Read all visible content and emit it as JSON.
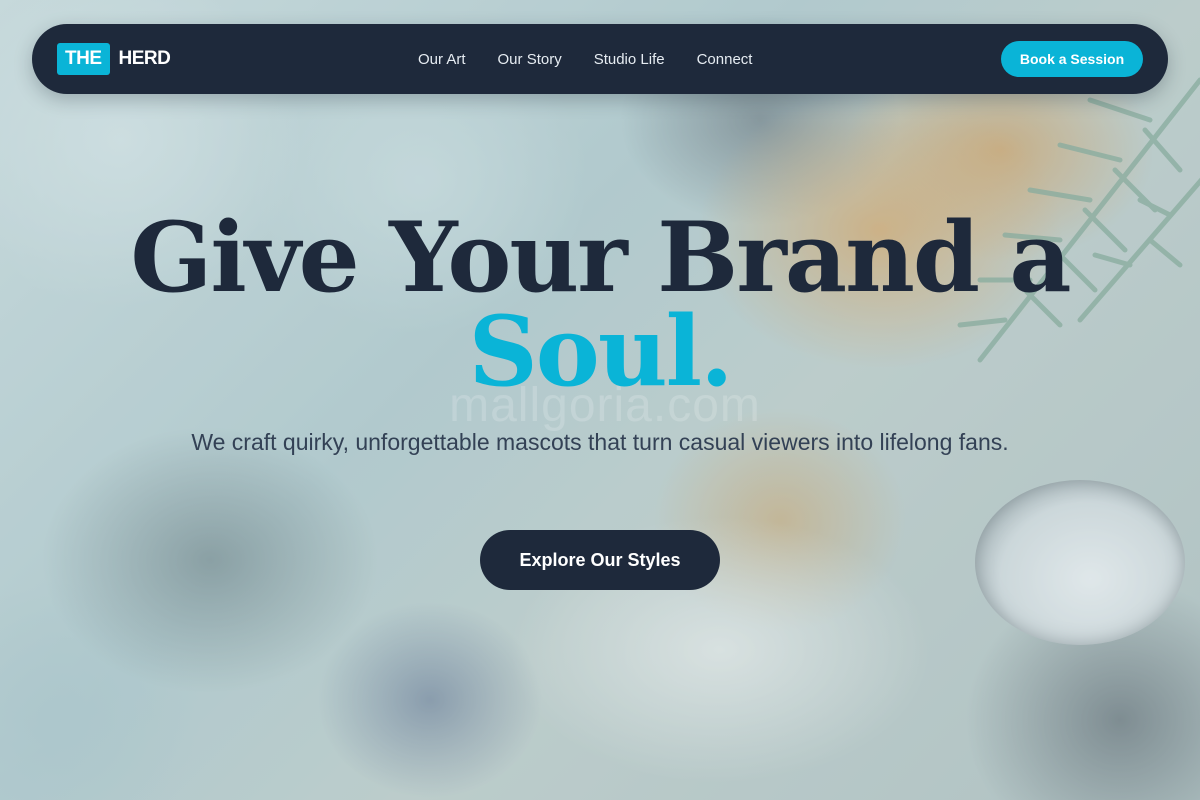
{
  "brand": {
    "mark": "THE",
    "name": "HERD"
  },
  "nav": {
    "links": [
      "Our Art",
      "Our Story",
      "Studio Life",
      "Connect"
    ],
    "cta_label": "Book a Session"
  },
  "hero": {
    "title_line1": "Give Your Brand a",
    "title_accent": "Soul.",
    "subtitle": "We craft quirky, unforgettable mascots that turn casual viewers into lifelong fans.",
    "button_label": "Explore Our Styles"
  },
  "watermark": "mallgoria.com",
  "colors": {
    "navy": "#1e293b",
    "accent": "#0ab4d7",
    "white": "#ffffff"
  }
}
